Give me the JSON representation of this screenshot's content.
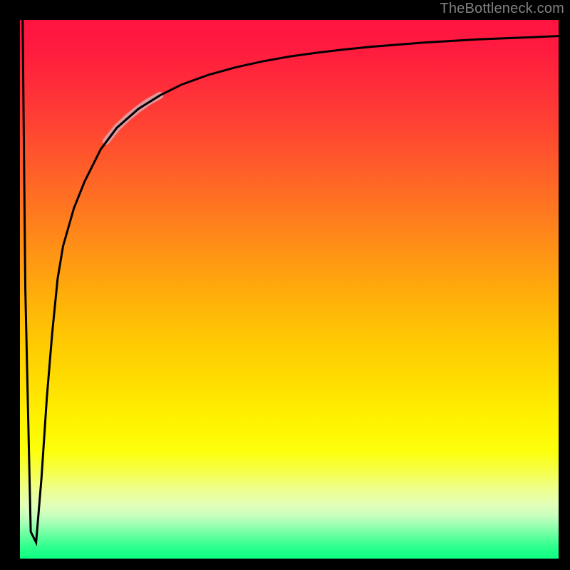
{
  "watermark": "TheBottleneck.com",
  "chart_data": {
    "type": "line",
    "title": "",
    "xlabel": "",
    "ylabel": "",
    "xlim": [
      0,
      100
    ],
    "ylim": [
      0,
      100
    ],
    "series": [
      {
        "name": "bottleneck-curve",
        "x": [
          0.5,
          1.0,
          2.0,
          3.0,
          4.0,
          5.0,
          6.0,
          7.0,
          8.0,
          10,
          12,
          15,
          18,
          22,
          26,
          30,
          35,
          40,
          45,
          50,
          55,
          60,
          65,
          70,
          75,
          80,
          85,
          90,
          95,
          100
        ],
        "values": [
          100,
          50,
          5,
          3,
          15,
          30,
          42,
          52,
          58,
          65,
          70,
          76,
          80,
          83.5,
          86,
          88,
          89.8,
          91.2,
          92.3,
          93.2,
          93.9,
          94.5,
          95.0,
          95.4,
          95.8,
          96.1,
          96.4,
          96.6,
          96.8,
          97.0
        ]
      }
    ],
    "highlight_segment": {
      "x": [
        16,
        18,
        20,
        22,
        24,
        26
      ],
      "values": [
        77.5,
        80,
        81.9,
        83.5,
        84.9,
        86
      ]
    },
    "background_gradient": {
      "orientation": "vertical",
      "stops": [
        {
          "pos": 0.0,
          "color": "#ff1440",
          "meaning": "high-bottleneck"
        },
        {
          "pos": 0.5,
          "color": "#ffb000",
          "meaning": "mid"
        },
        {
          "pos": 0.8,
          "color": "#fff200",
          "meaning": "low"
        },
        {
          "pos": 1.0,
          "color": "#0cff82",
          "meaning": "no-bottleneck"
        }
      ]
    }
  },
  "plot": {
    "inner_left": 28,
    "inner_top": 28,
    "inner_width": 756,
    "inner_height": 756
  }
}
